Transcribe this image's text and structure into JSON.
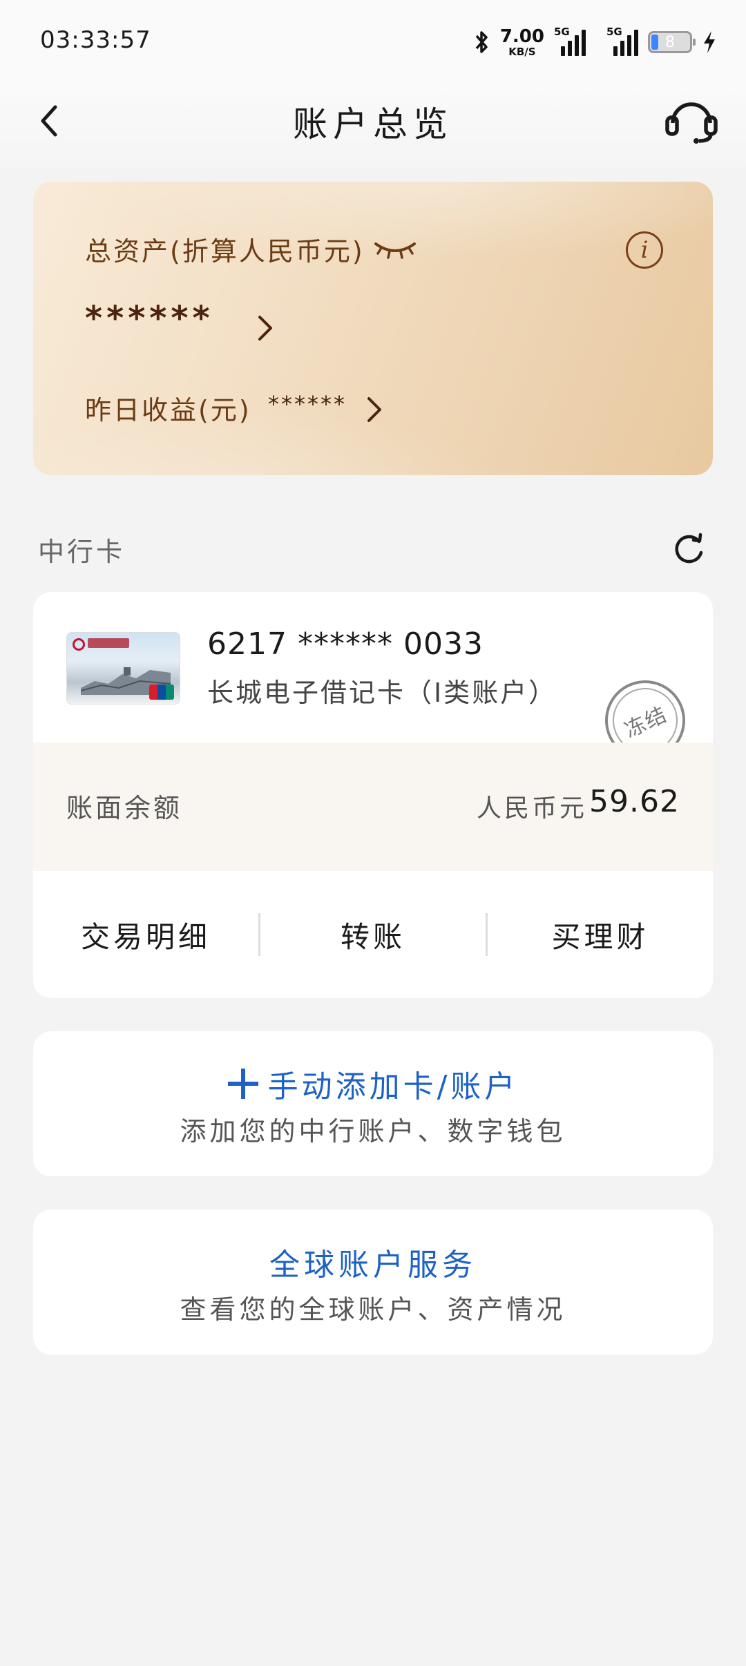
{
  "status_bar": {
    "time": "03:33:57",
    "net_speed_value": "7.00",
    "net_speed_unit": "KB/S",
    "sim1_tag": "5G",
    "sim2_tag": "5G",
    "battery_level": "8",
    "icons": [
      "bluetooth-icon",
      "signal-icon",
      "battery-icon",
      "charging-icon"
    ]
  },
  "header": {
    "title": "账户总览",
    "back_icon": "chevron-left-icon",
    "service_icon": "headset-icon"
  },
  "assets": {
    "total_label": "总资产(折算人民币元)",
    "total_value": "******",
    "yesterday_label": "昨日收益(元)",
    "yesterday_value": "******",
    "info_glyph": "i"
  },
  "section": {
    "title": "中行卡"
  },
  "account": {
    "card_number": "6217 ****** 0033",
    "card_name": "长城电子借记卡（I类账户）",
    "status_stamp": "冻结",
    "balance_label": "账面余额",
    "currency": "人民币元",
    "amount": "59.62",
    "actions": [
      {
        "label": "交易明细"
      },
      {
        "label": "转账"
      },
      {
        "label": "买理财"
      }
    ]
  },
  "add_account": {
    "title": "手动添加卡/账户",
    "subtitle": "添加您的中行账户、数字钱包"
  },
  "global_service": {
    "title": "全球账户服务",
    "subtitle": "查看您的全球账户、资产情况"
  },
  "colors": {
    "accent_blue": "#1d62c4",
    "asset_text_brown": "#6b3b14",
    "page_bg": "#f3f3f4"
  }
}
